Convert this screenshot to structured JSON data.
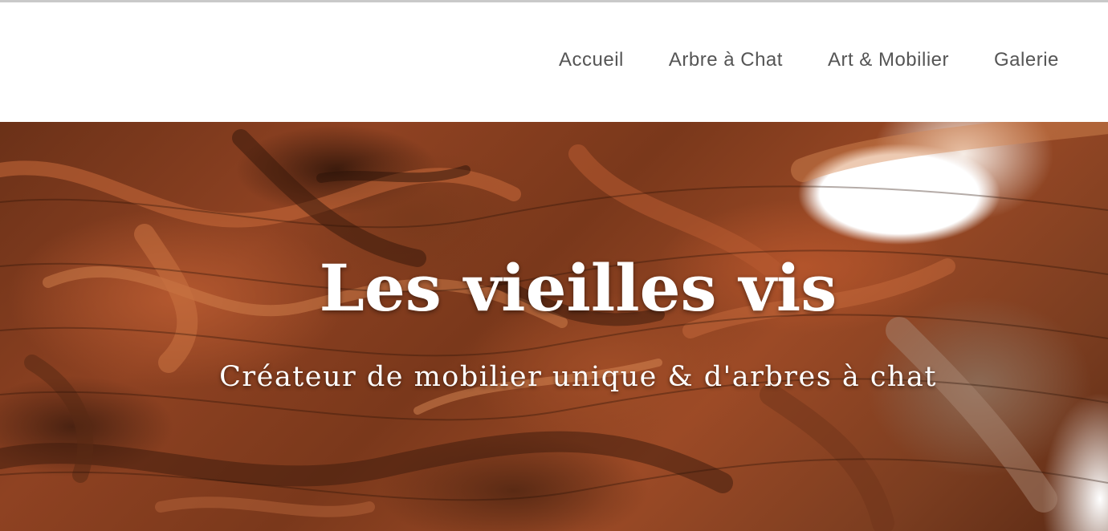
{
  "nav": {
    "items": [
      {
        "label": "Accueil"
      },
      {
        "label": "Arbre à Chat"
      },
      {
        "label": "Art & Mobilier"
      },
      {
        "label": "Galerie"
      }
    ]
  },
  "hero": {
    "title": "Les vieilles vis",
    "subtitle": "Créateur de mobilier unique & d'arbres à chat",
    "image": "driftwood-root-image"
  },
  "colors": {
    "nav_text": "#555555",
    "hero_text": "#ffffff",
    "wood": "#8f4222"
  }
}
